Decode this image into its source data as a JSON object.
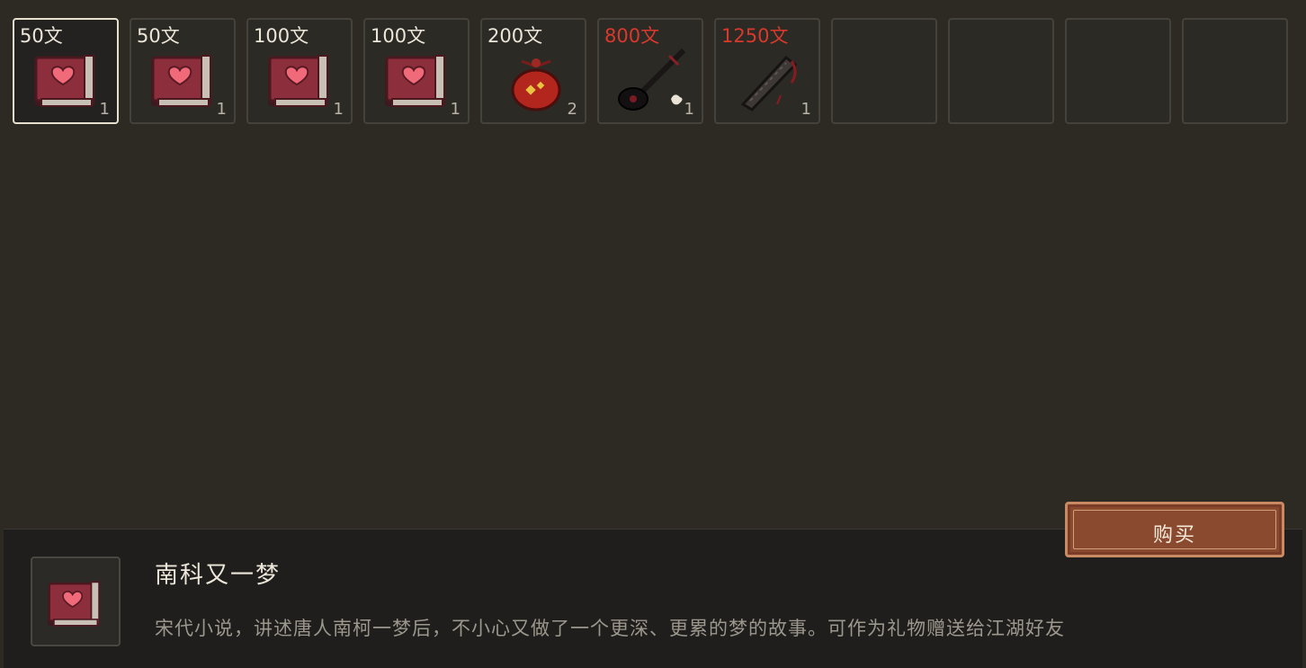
{
  "colors": {
    "background": "#2d2a24",
    "price_affordable": "#ece6d9",
    "price_unaffordable": "#d9392c",
    "buy_button": "#8a4a30"
  },
  "shop": {
    "slots": [
      {
        "price": "50文",
        "quantity": "1",
        "icon": "romance-book-icon",
        "affordable": true,
        "selected": true
      },
      {
        "price": "50文",
        "quantity": "1",
        "icon": "romance-book-icon",
        "affordable": true
      },
      {
        "price": "100文",
        "quantity": "1",
        "icon": "romance-book-icon",
        "affordable": true
      },
      {
        "price": "100文",
        "quantity": "1",
        "icon": "romance-book-icon",
        "affordable": true
      },
      {
        "price": "200文",
        "quantity": "2",
        "icon": "red-pouch-icon",
        "affordable": true
      },
      {
        "price": "800文",
        "quantity": "1",
        "icon": "pipa-instrument-icon",
        "affordable": false
      },
      {
        "price": "1250文",
        "quantity": "1",
        "icon": "dark-blade-icon",
        "affordable": false
      },
      {
        "empty": true
      },
      {
        "empty": true
      },
      {
        "empty": true
      },
      {
        "empty": true
      }
    ]
  },
  "detail": {
    "icon": "romance-book-icon",
    "name": "南科又一梦",
    "description": "宋代小说，讲述唐人南柯一梦后，不小心又做了一个更深、更累的梦的故事。可作为礼物赠送给江湖好友"
  },
  "buy_button": {
    "label": "购买"
  }
}
